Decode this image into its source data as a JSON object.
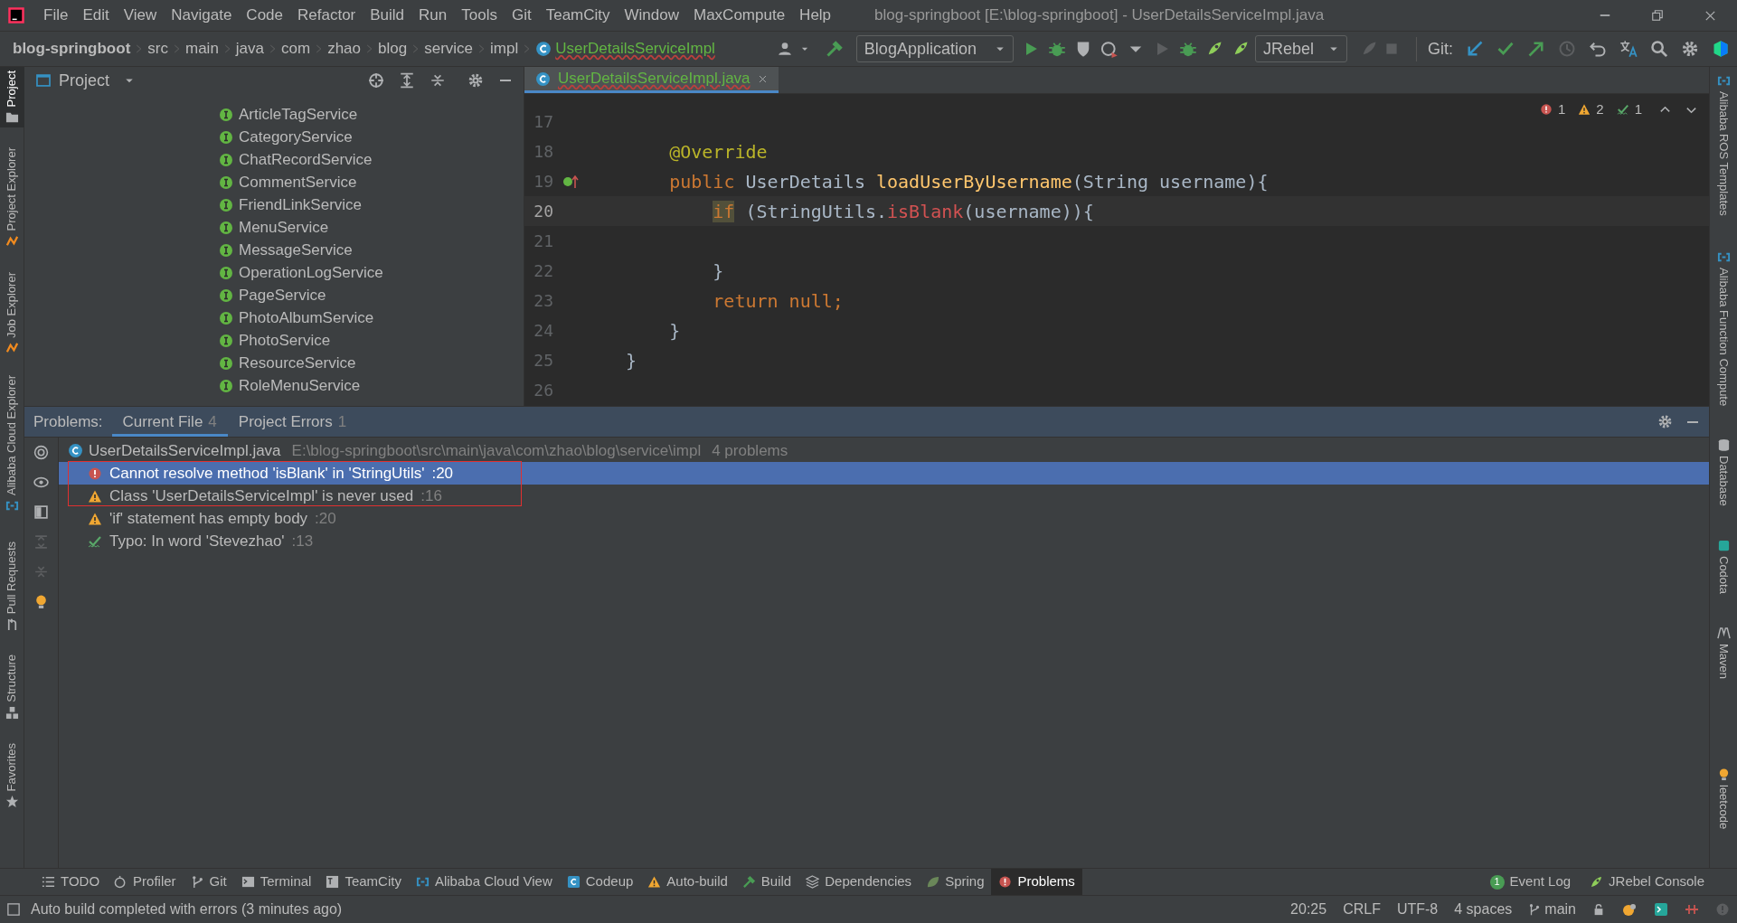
{
  "window": {
    "title": "blog-springboot [E:\\blog-springboot] - UserDetailsServiceImpl.java"
  },
  "menu": [
    "File",
    "Edit",
    "View",
    "Navigate",
    "Code",
    "Refactor",
    "Build",
    "Run",
    "Tools",
    "Git",
    "TeamCity",
    "Window",
    "MaxCompute",
    "Help"
  ],
  "breadcrumbs": [
    {
      "label": "blog-springboot",
      "kind": "project"
    },
    {
      "label": "src",
      "kind": "dir"
    },
    {
      "label": "main",
      "kind": "dir"
    },
    {
      "label": "java",
      "kind": "dir"
    },
    {
      "label": "com",
      "kind": "dir"
    },
    {
      "label": "zhao",
      "kind": "dir"
    },
    {
      "label": "blog",
      "kind": "dir"
    },
    {
      "label": "service",
      "kind": "dir"
    },
    {
      "label": "impl",
      "kind": "dir"
    },
    {
      "label": "UserDetailsServiceImpl",
      "kind": "class"
    }
  ],
  "toolbar": {
    "run_configuration": "BlogApplication",
    "jrebel": "JRebel",
    "git_label": "Git:"
  },
  "left_strip": [
    {
      "label": "Project",
      "selected": true
    },
    {
      "label": "Project Explorer",
      "selected": false
    },
    {
      "label": "Job Explorer",
      "selected": false
    },
    {
      "label": "Alibaba Cloud Explorer",
      "selected": false
    },
    {
      "label": "Pull Requests",
      "selected": false
    },
    {
      "label": "Structure",
      "selected": false
    },
    {
      "label": "Favorites",
      "selected": false
    }
  ],
  "right_strip": [
    "Alibaba ROS Templates",
    "Alibaba Function Compute",
    "Database",
    "Codota",
    "Maven",
    "leetcode"
  ],
  "project_panel": {
    "title": "Project",
    "items": [
      "ArticleTagService",
      "CategoryService",
      "ChatRecordService",
      "CommentService",
      "FriendLinkService",
      "MenuService",
      "MessageService",
      "OperationLogService",
      "PageService",
      "PhotoAlbumService",
      "PhotoService",
      "ResourceService",
      "RoleMenuService"
    ]
  },
  "editor": {
    "tab": "UserDetailsServiceImpl.java",
    "inspections": {
      "errors": "1",
      "warnings": "2",
      "typos": "1"
    },
    "lines": [
      {
        "number": "17",
        "current": false
      },
      {
        "number": "18",
        "current": false,
        "tokens": [
          {
            "text": "    @Override",
            "kind": "annotation"
          }
        ]
      },
      {
        "number": "19",
        "current": false,
        "implementation_marker": true,
        "tokens": [
          {
            "text": "    public",
            "kind": "keyword"
          },
          {
            "text": " UserDetails "
          },
          {
            "text": "loadUserByUsername",
            "kind": "method"
          },
          {
            "text": "(String username){"
          }
        ]
      },
      {
        "number": "20",
        "current": true,
        "tokens": [
          {
            "text": "        if",
            "kind": "keyword-warning"
          },
          {
            "text": " (StringUtils."
          },
          {
            "text": "isBlank",
            "kind": "error"
          },
          {
            "text": "(username)){"
          }
        ]
      },
      {
        "number": "21",
        "current": false
      },
      {
        "number": "22",
        "current": false,
        "tokens": [
          {
            "text": "        }"
          }
        ]
      },
      {
        "number": "23",
        "current": false,
        "tokens": [
          {
            "text": "        return null;",
            "kind": "keyword"
          }
        ]
      },
      {
        "number": "24",
        "current": false,
        "tokens": [
          {
            "text": "    }"
          }
        ]
      },
      {
        "number": "25",
        "current": false,
        "tokens": [
          {
            "text": "}"
          }
        ]
      },
      {
        "number": "26",
        "current": false
      }
    ]
  },
  "problems": {
    "label": "Problems:",
    "tabs": [
      {
        "label": "Current File",
        "count": "4",
        "selected": true
      },
      {
        "label": "Project Errors",
        "count": "1",
        "selected": false
      }
    ],
    "file": {
      "name": "UserDetailsServiceImpl.java",
      "path": "E:\\blog-springboot\\src\\main\\java\\com\\zhao\\blog\\service\\impl",
      "count": "4 problems"
    },
    "items": [
      {
        "kind": "error",
        "text": "Cannot resolve method 'isBlank' in 'StringUtils'",
        "line": ":20",
        "selected": true
      },
      {
        "kind": "warning",
        "text": "Class 'UserDetailsServiceImpl' is never used",
        "line": ":16",
        "selected": false
      },
      {
        "kind": "warning",
        "text": "'if' statement has empty body",
        "line": ":20",
        "selected": false
      },
      {
        "kind": "typo",
        "text": "Typo: In word 'Stevezhao'",
        "line": ":13",
        "selected": false
      }
    ]
  },
  "tool_windows": [
    {
      "label": "TODO",
      "selected": false
    },
    {
      "label": "Profiler",
      "selected": false
    },
    {
      "label": "Git",
      "selected": false
    },
    {
      "label": "Terminal",
      "selected": false
    },
    {
      "label": "TeamCity",
      "selected": false
    },
    {
      "label": "Alibaba Cloud View",
      "selected": false
    },
    {
      "label": "Codeup",
      "selected": false
    },
    {
      "label": "Auto-build",
      "selected": false
    },
    {
      "label": "Build",
      "selected": false
    },
    {
      "label": "Dependencies",
      "selected": false
    },
    {
      "label": "Spring",
      "selected": false
    },
    {
      "label": "Problems",
      "selected": true
    }
  ],
  "tool_windows_right": [
    {
      "label": "Event Log",
      "badge": "1"
    },
    {
      "label": "JRebel Console"
    }
  ],
  "status_bar": {
    "message": "Auto build completed with errors (3 minutes ago)",
    "position": "20:25",
    "line_separator": "CRLF",
    "encoding": "UTF-8",
    "indent": "4 spaces",
    "branch": "main"
  }
}
